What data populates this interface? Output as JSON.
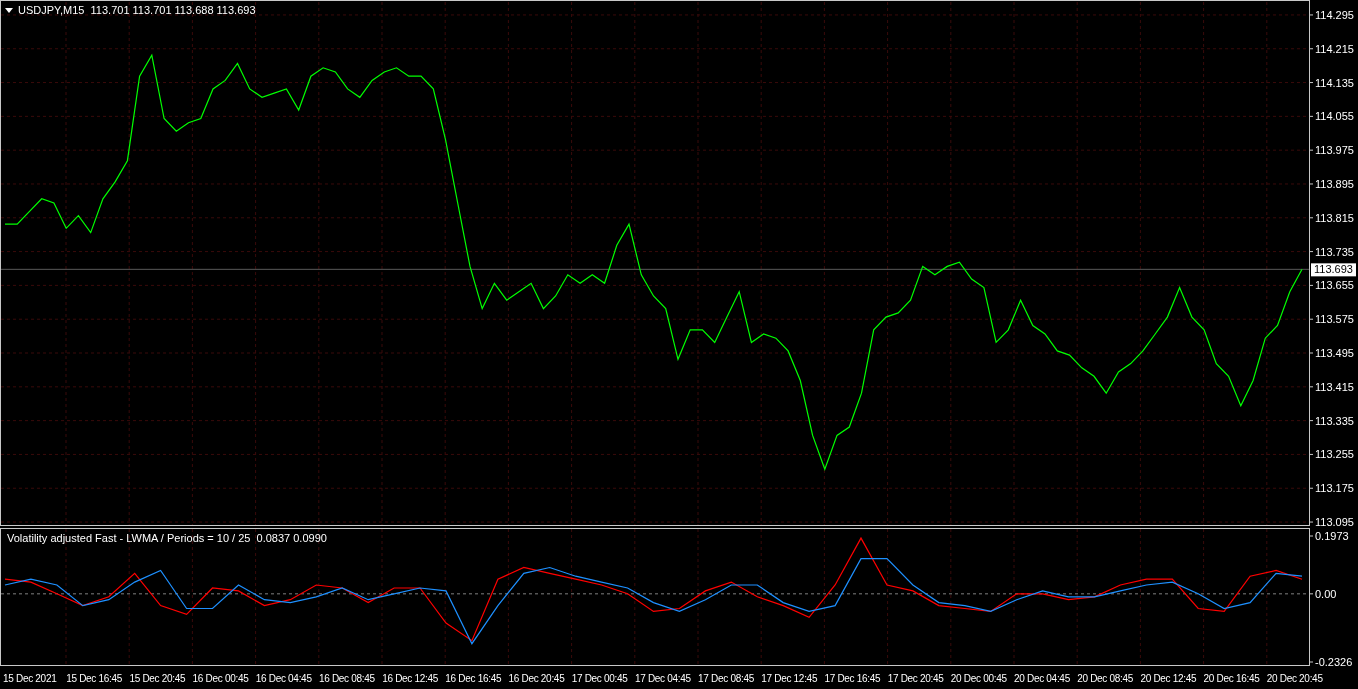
{
  "price_chart": {
    "chart_data": {
      "type": "line",
      "title": "USDJPY,M15  113.701 113.701 113.688 113.693",
      "ylim": [
        113.088,
        114.328
      ],
      "grid": true,
      "ref_lines": [
        {
          "axis": "y",
          "value": 113.693,
          "label": "113.693"
        }
      ],
      "yticks": [
        {
          "value": 114.295,
          "label": "114.295"
        },
        {
          "value": 114.215,
          "label": "114.215"
        },
        {
          "value": 114.135,
          "label": "114.135"
        },
        {
          "value": 114.055,
          "label": "114.055"
        },
        {
          "value": 113.975,
          "label": "113.975"
        },
        {
          "value": 113.895,
          "label": "113.895"
        },
        {
          "value": 113.815,
          "label": "113.815"
        },
        {
          "value": 113.735,
          "label": "113.735"
        },
        {
          "value": 113.655,
          "label": "113.655"
        },
        {
          "value": 113.575,
          "label": "113.575"
        },
        {
          "value": 113.495,
          "label": "113.495"
        },
        {
          "value": 113.415,
          "label": "113.415"
        },
        {
          "value": 113.335,
          "label": "113.335"
        },
        {
          "value": 113.255,
          "label": "113.255"
        },
        {
          "value": 113.175,
          "label": "113.175"
        },
        {
          "value": 113.095,
          "label": "113.095"
        }
      ],
      "series": [
        {
          "color": "#00ff00",
          "values": [
            113.8,
            113.8,
            113.83,
            113.86,
            113.85,
            113.79,
            113.82,
            113.78,
            113.86,
            113.9,
            113.95,
            114.15,
            114.2,
            114.05,
            114.02,
            114.04,
            114.05,
            114.12,
            114.14,
            114.18,
            114.12,
            114.1,
            114.11,
            114.12,
            114.07,
            114.15,
            114.17,
            114.16,
            114.12,
            114.1,
            114.14,
            114.16,
            114.17,
            114.15,
            114.15,
            114.12,
            114.0,
            113.85,
            113.7,
            113.6,
            113.66,
            113.62,
            113.64,
            113.66,
            113.6,
            113.63,
            113.68,
            113.66,
            113.68,
            113.66,
            113.75,
            113.8,
            113.68,
            113.63,
            113.6,
            113.48,
            113.55,
            113.55,
            113.52,
            113.58,
            113.64,
            113.52,
            113.54,
            113.53,
            113.5,
            113.43,
            113.3,
            113.22,
            113.3,
            113.32,
            113.4,
            113.55,
            113.58,
            113.59,
            113.62,
            113.7,
            113.68,
            113.7,
            113.71,
            113.67,
            113.65,
            113.52,
            113.55,
            113.62,
            113.56,
            113.54,
            113.5,
            113.49,
            113.46,
            113.44,
            113.4,
            113.45,
            113.47,
            113.5,
            113.54,
            113.58,
            113.65,
            113.58,
            113.55,
            113.47,
            113.44,
            113.37,
            113.43,
            113.53,
            113.56,
            113.64,
            113.693
          ]
        }
      ]
    }
  },
  "indicator": {
    "chart_data": {
      "type": "line",
      "title": "Volatility adjusted Fast - LWMA / Periods = 10 / 25  0.0837 0.0990",
      "ylim": [
        -0.2428,
        0.2212
      ],
      "grid": true,
      "ref_lines": [
        {
          "axis": "y",
          "value": 0,
          "label": "0.00"
        }
      ],
      "yticks": [
        {
          "value": 0.1973,
          "label": "0.1973"
        },
        {
          "value": -0.2326,
          "label": "-0.2326"
        }
      ],
      "series": [
        {
          "color": "#ff0000",
          "values": [
            0.05,
            0.04,
            0.0,
            -0.04,
            -0.01,
            0.07,
            -0.04,
            -0.07,
            0.02,
            0.01,
            -0.04,
            -0.02,
            0.03,
            0.02,
            -0.03,
            0.02,
            0.02,
            -0.1,
            -0.16,
            0.05,
            0.09,
            0.07,
            0.05,
            0.03,
            0.0,
            -0.06,
            -0.05,
            0.01,
            0.04,
            -0.01,
            -0.04,
            -0.08,
            0.03,
            0.19,
            0.03,
            0.01,
            -0.04,
            -0.05,
            -0.06,
            0.0,
            0.0,
            -0.02,
            -0.01,
            0.03,
            0.05,
            0.05,
            -0.05,
            -0.06,
            0.06,
            0.08,
            0.05
          ]
        },
        {
          "color": "#1e90ff",
          "values": [
            0.03,
            0.05,
            0.03,
            -0.04,
            -0.02,
            0.04,
            0.08,
            -0.05,
            -0.05,
            0.03,
            -0.02,
            -0.03,
            -0.01,
            0.02,
            -0.02,
            0.0,
            0.02,
            0.01,
            -0.17,
            -0.04,
            0.07,
            0.09,
            0.06,
            0.04,
            0.02,
            -0.03,
            -0.06,
            -0.02,
            0.03,
            0.03,
            -0.03,
            -0.06,
            -0.04,
            0.12,
            0.12,
            0.03,
            -0.03,
            -0.04,
            -0.06,
            -0.02,
            0.01,
            -0.01,
            -0.01,
            0.01,
            0.03,
            0.04,
            0.0,
            -0.05,
            -0.03,
            0.07,
            0.06
          ]
        }
      ]
    }
  },
  "time_axis": [
    "15 Dec 2021",
    "15 Dec 16:45",
    "15 Dec 20:45",
    "16 Dec 00:45",
    "16 Dec 04:45",
    "16 Dec 08:45",
    "16 Dec 12:45",
    "16 Dec 16:45",
    "16 Dec 20:45",
    "17 Dec 00:45",
    "17 Dec 04:45",
    "17 Dec 08:45",
    "17 Dec 12:45",
    "17 Dec 16:45",
    "17 Dec 20:45",
    "20 Dec 00:45",
    "20 Dec 04:45",
    "20 Dec 08:45",
    "20 Dec 12:45",
    "20 Dec 16:45",
    "20 Dec 20:45"
  ]
}
